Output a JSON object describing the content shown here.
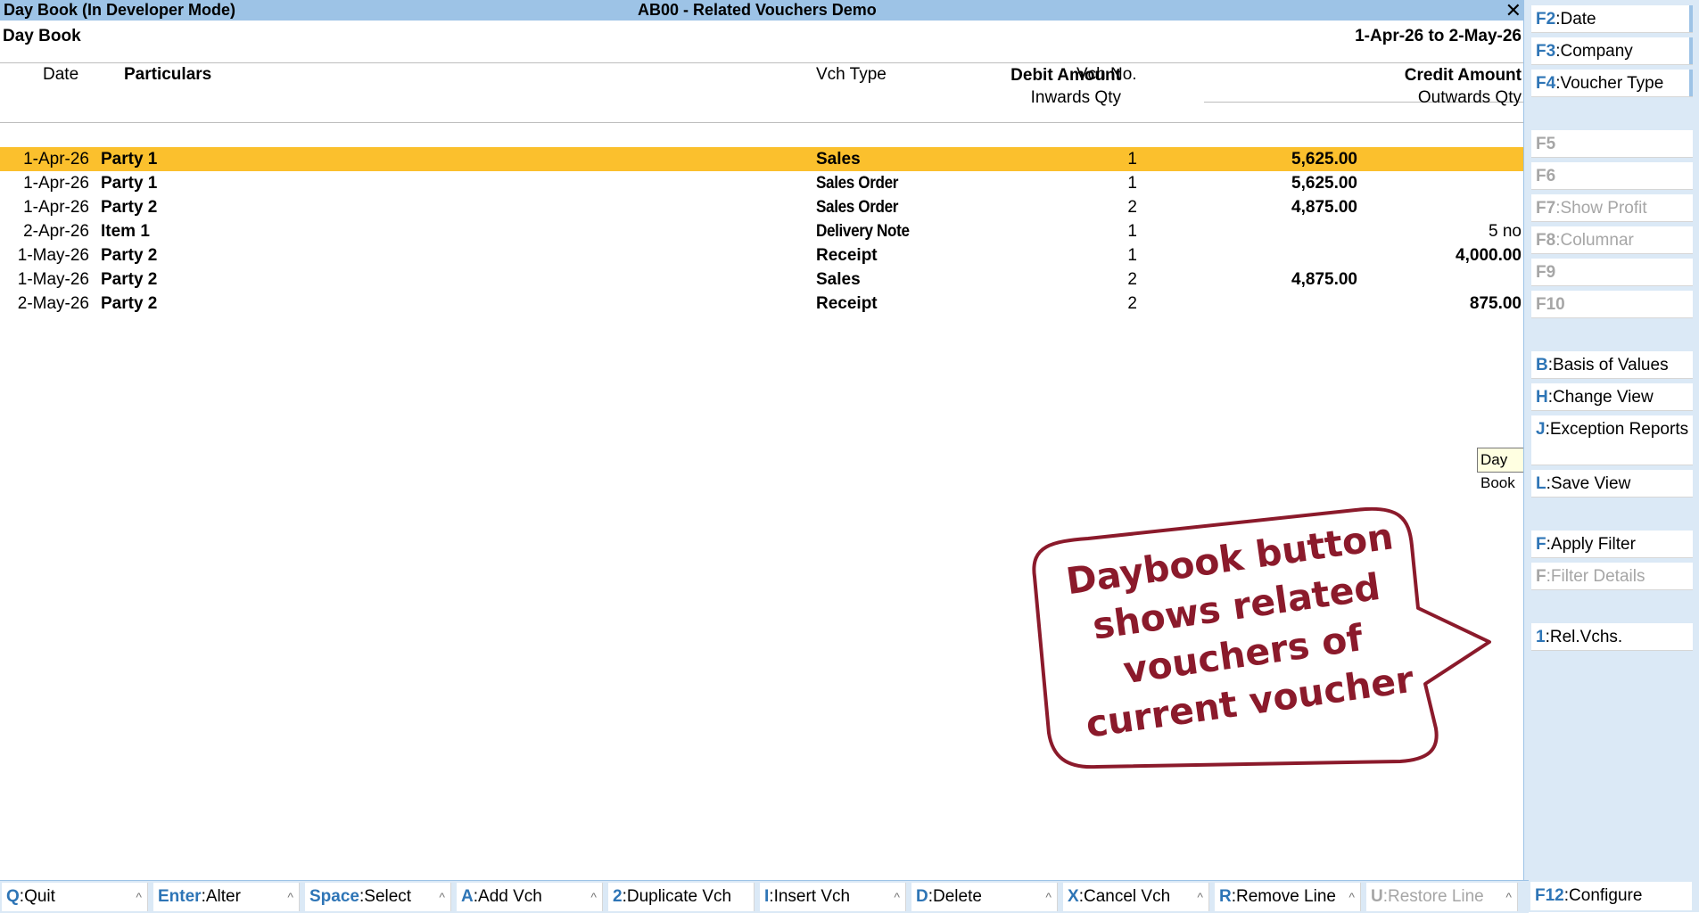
{
  "window": {
    "title_left": "Day Book (In Developer Mode)",
    "title_center": "AB00 - Related Vouchers Demo",
    "close_glyph": "✕"
  },
  "report": {
    "title": "Day Book",
    "period": "1-Apr-26 to 2-May-26"
  },
  "columns": {
    "date": "Date",
    "particulars": "Particulars",
    "vch_type": "Vch Type",
    "vch_no": "Vch No.",
    "debit": "Debit Amount",
    "credit": "Credit Amount",
    "inwards": "Inwards Qty",
    "outwards": "Outwards Qty"
  },
  "rows": [
    {
      "date": "1-Apr-26",
      "particulars": "Party 1",
      "vch_type": "Sales",
      "vch_no": "1",
      "debit": "5,625.00",
      "credit": ""
    },
    {
      "date": "1-Apr-26",
      "particulars": "Party 1",
      "vch_type": "Sales Order",
      "vch_no": "1",
      "debit": "5,625.00",
      "credit": ""
    },
    {
      "date": "1-Apr-26",
      "particulars": "Party 2",
      "vch_type": "Sales Order",
      "vch_no": "2",
      "debit": "4,875.00",
      "credit": ""
    },
    {
      "date": "2-Apr-26",
      "particulars": "Item 1",
      "vch_type": "Delivery Note",
      "vch_no": "1",
      "debit": "",
      "credit": "5 no"
    },
    {
      "date": "1-May-26",
      "particulars": "Party 2",
      "vch_type": "Receipt",
      "vch_no": "1",
      "debit": "",
      "credit": "4,000.00"
    },
    {
      "date": "1-May-26",
      "particulars": "Party 2",
      "vch_type": "Sales",
      "vch_no": "2",
      "debit": "4,875.00",
      "credit": ""
    },
    {
      "date": "2-May-26",
      "particulars": "Party 2",
      "vch_type": "Receipt",
      "vch_no": "2",
      "debit": "",
      "credit": "875.00"
    }
  ],
  "tooltip": "Day Book",
  "callout": "Daybook button shows related vouchers of current voucher",
  "right_panel": [
    {
      "key": "F2",
      "label": "Date"
    },
    {
      "key": "F3",
      "label": "Company"
    },
    {
      "key": "F4",
      "label": "Voucher Type"
    },
    {
      "key": "F5",
      "label": ""
    },
    {
      "key": "F6",
      "label": ""
    },
    {
      "key": "F7",
      "label": "Show Profit"
    },
    {
      "key": "F8",
      "label": "Columnar"
    },
    {
      "key": "F9",
      "label": ""
    },
    {
      "key": "F10",
      "label": ""
    },
    {
      "key": "B",
      "label": "Basis of Values"
    },
    {
      "key": "H",
      "label": "Change View"
    },
    {
      "key": "J",
      "label": "Exception Reports"
    },
    {
      "key": "L",
      "label": "Save View"
    },
    {
      "key": "F",
      "label": "Apply Filter"
    },
    {
      "key": "F",
      "label": "Filter Details"
    },
    {
      "key": "1",
      "label": "Rel.Vchs."
    }
  ],
  "bottom_bar": [
    {
      "key": "Q",
      "label": "Quit"
    },
    {
      "key": "Enter",
      "label": "Alter"
    },
    {
      "key": "Space",
      "label": "Select"
    },
    {
      "key": "A",
      "label": "Add Vch"
    },
    {
      "key": "2",
      "label": "Duplicate Vch"
    },
    {
      "key": "I",
      "label": "Insert Vch"
    },
    {
      "key": "D",
      "label": "Delete"
    },
    {
      "key": "X",
      "label": "Cancel Vch"
    },
    {
      "key": "R",
      "label": "Remove Line"
    },
    {
      "key": "U",
      "label": "Restore Line"
    }
  ],
  "caret_glyph": "^",
  "configure": {
    "key": "F12",
    "label": "Configure"
  },
  "colors": {
    "title_bar": "#9dc3e6",
    "selected_row": "#fbc02d",
    "key_text": "#2e75b6",
    "callout": "#8b1a2b",
    "panel_bg": "#dbe9f6"
  }
}
